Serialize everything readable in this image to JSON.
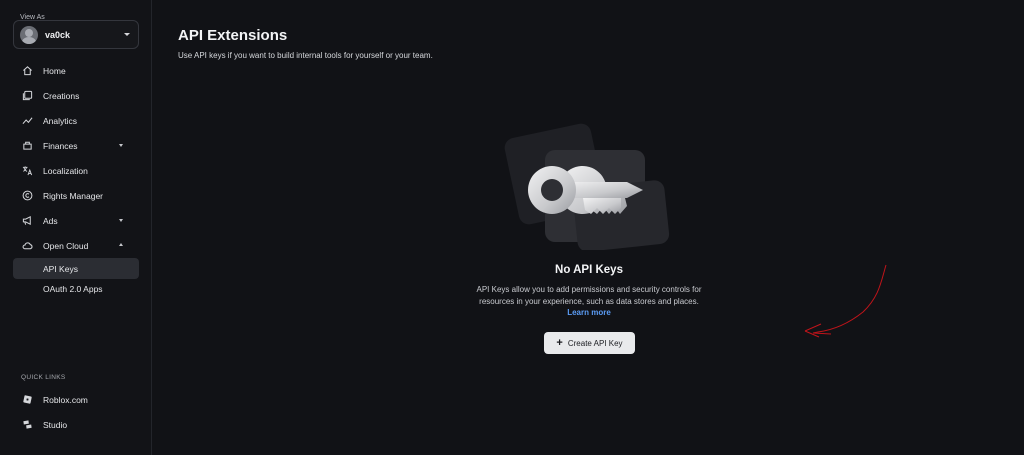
{
  "sidebar": {
    "view_as_label": "View As",
    "account_name": "va0ck",
    "items": [
      {
        "label": "Home",
        "icon": "home-icon"
      },
      {
        "label": "Creations",
        "icon": "creations-icon"
      },
      {
        "label": "Analytics",
        "icon": "analytics-icon"
      },
      {
        "label": "Finances",
        "icon": "finances-icon"
      },
      {
        "label": "Localization",
        "icon": "translate-icon"
      },
      {
        "label": "Rights Manager",
        "icon": "copyright-icon"
      },
      {
        "label": "Ads",
        "icon": "megaphone-icon"
      },
      {
        "label": "Open Cloud",
        "icon": "cloud-icon"
      },
      {
        "label": "API Keys"
      },
      {
        "label": "OAuth 2.0 Apps"
      }
    ],
    "quick_links_title": "QUICK LINKS",
    "quick_links": [
      {
        "label": "Roblox.com",
        "icon": "roblox-logo-icon"
      },
      {
        "label": "Studio",
        "icon": "studio-logo-icon"
      }
    ]
  },
  "main": {
    "title": "API Extensions",
    "subtitle": "Use API keys if you want to build internal tools for yourself or your team.",
    "empty_state": {
      "title": "No API Keys",
      "description_line1": "API Keys allow you to add permissions and security controls for",
      "description_line2": "resources in your experience, such as data stores and places.",
      "learn_more": "Learn more",
      "create_button": "Create API Key"
    }
  },
  "colors": {
    "background": "#111216",
    "active_item": "#2b2d33",
    "link": "#5b9cf5",
    "button": "#e9eaec",
    "annotation": "#c0141a"
  }
}
